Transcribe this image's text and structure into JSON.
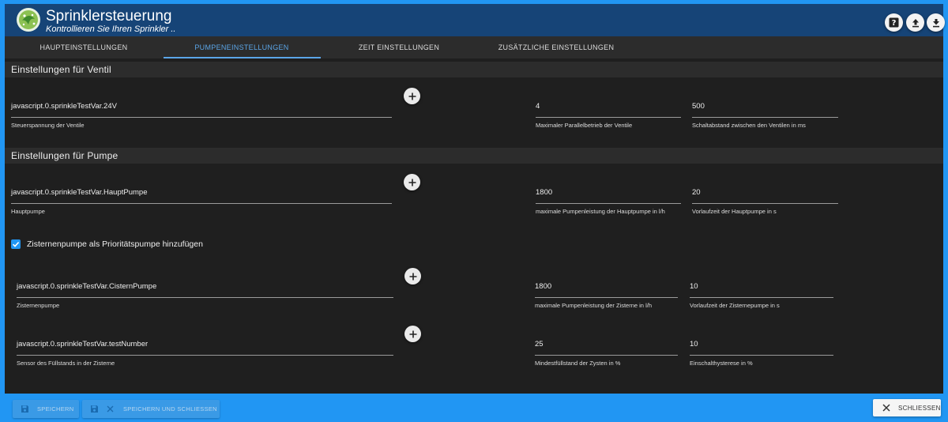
{
  "header": {
    "title": "Sprinklersteuerung",
    "subtitle": "Kontrollieren Sie Ihren Sprinkler .."
  },
  "tabs": [
    {
      "label": "HAUPTEINSTELLUNGEN",
      "active": false
    },
    {
      "label": "PUMPENEINSTELLUNGEN",
      "active": true
    },
    {
      "label": "ZEIT EINSTELLUNGEN",
      "active": false
    },
    {
      "label": "ZUSÄTZLICHE EINSTELLUNGEN",
      "active": false
    }
  ],
  "ventil": {
    "section_title": "Einstellungen für Ventil",
    "control_voltage": {
      "value": "javascript.0.sprinkleTestVar.24V",
      "label": "Steuerspannung der Ventile"
    },
    "max_parallel": {
      "value": "4",
      "label": "Maximaler Parallelbetrieb der Ventile"
    },
    "switch_interval": {
      "value": "500",
      "label": "Schaltabstand zwischen den Ventilen in ms"
    }
  },
  "pumpe": {
    "section_title": "Einstellungen für Pumpe",
    "main_pump": {
      "value": "javascript.0.sprinkleTestVar.HauptPumpe",
      "label": "Hauptpumpe"
    },
    "main_pump_capacity": {
      "value": "1800",
      "label": "maximale Pumpenleistung der Hauptpumpe in l/h"
    },
    "main_pump_lead_time": {
      "value": "20",
      "label": "Vorlaufzeit der Hauptpumpe in s"
    },
    "cistern_checkbox": {
      "label": "Zisternenpumpe als Prioritätspumpe hinzufügen",
      "checked": true
    },
    "cistern_pump": {
      "value": "javascript.0.sprinkleTestVar.CisternPumpe",
      "label": "Zisternenpumpe"
    },
    "cistern_capacity": {
      "value": "1800",
      "label": "maximale Pumpenleistung der Zisterne in l/h"
    },
    "cistern_lead_time": {
      "value": "10",
      "label": "Vorlaufzeit der Zisternepumpe in s"
    },
    "level_sensor": {
      "value": "javascript.0.sprinkleTestVar.testNumber",
      "label": "Sensor des Füllstands in der Zisterne"
    },
    "min_level": {
      "value": "25",
      "label": "Mindestfüllstand der Zysten in %"
    },
    "hysteresis": {
      "value": "10",
      "label": "Einschalthysterese in %"
    }
  },
  "footer": {
    "save_label": "SPEICHERN",
    "save_close_label": "SPEICHERN UND SCHLIESSEN",
    "close_label": "SCHLIESSEN"
  },
  "colors": {
    "accent": "#2196f3",
    "header_bg": "#164477",
    "content_bg": "#1f1f1f",
    "tab_active": "#5ba6e8"
  }
}
